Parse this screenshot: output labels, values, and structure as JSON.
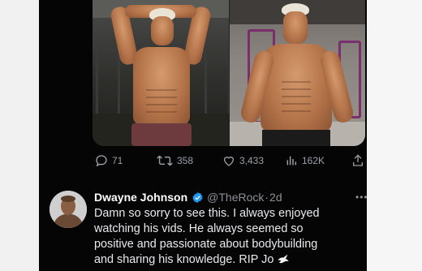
{
  "tweet": {
    "media": {
      "image_1": {
        "description_icon": "bodybuilder-photo-1"
      },
      "image_2": {
        "description_icon": "bodybuilder-photo-2"
      }
    },
    "actions": {
      "replies": "71",
      "reposts": "358",
      "likes": "3,433",
      "views": "162K"
    }
  },
  "reply": {
    "author_name": "Dwayne Johnson",
    "author_handle": "@TheRock",
    "separator": "·",
    "timestamp": "2d",
    "more_label": "•••",
    "text_lines": [
      "Damn so sorry to see this. I always enjoyed",
      "watching his vids. He always seemed so",
      "positive and passionate about bodybuilding",
      "and sharing his knowledge. RIP Jo"
    ],
    "emoji": "dove"
  },
  "colors": {
    "background": "#050505",
    "text_primary": "#e8eaed",
    "text_secondary": "#8b9096",
    "verified_blue": "#1d9bf0"
  }
}
